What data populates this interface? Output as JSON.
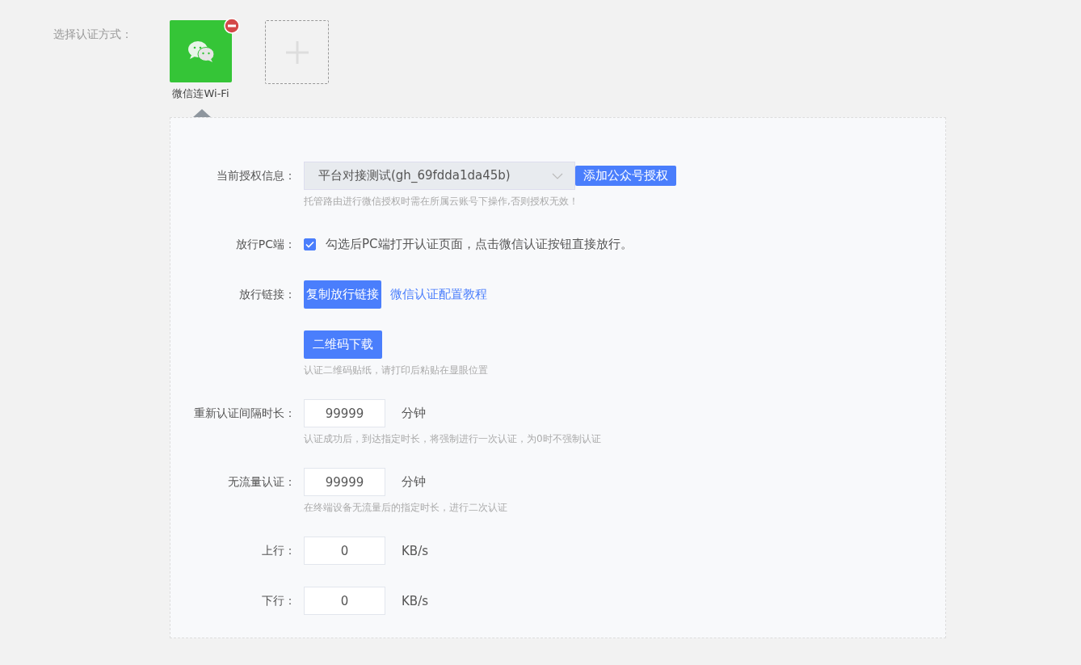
{
  "auth_method": {
    "label": "选择认证方式：",
    "methods": [
      {
        "name": "微信连Wi-Fi",
        "selected": true,
        "removable": true
      }
    ]
  },
  "panel": {
    "rows": [
      {
        "label": "当前授权信息：",
        "controls": [
          {
            "kind": "select",
            "value": "平台对接测试(gh_69fdda1da45b)"
          },
          {
            "kind": "small-button",
            "label": "添加公众号授权"
          }
        ],
        "hint": "托管路由进行微信授权时需在所属云账号下操作,否则授权无效！"
      },
      {
        "label": "放行PC端：",
        "controls": [
          {
            "kind": "checkbox",
            "checked": true,
            "label": "勾选后PC端打开认证页面，点击微信认证按钮直接放行。"
          }
        ]
      },
      {
        "label": "放行链接：",
        "controls": [
          {
            "kind": "button",
            "label": "复制放行链接"
          },
          {
            "kind": "link",
            "label": "微信认证配置教程"
          }
        ]
      },
      {
        "controls": [
          {
            "kind": "button",
            "label": "二维码下载"
          }
        ],
        "hint": "认证二维码贴纸，请打印后粘贴在显眼位置"
      },
      {
        "label": "重新认证间隔时长：",
        "controls": [
          {
            "kind": "input",
            "value": "99999"
          },
          {
            "kind": "unit",
            "label": "分钟"
          }
        ],
        "hint": "认证成功后，到达指定时长，将强制进行一次认证，为0时不强制认证"
      },
      {
        "label": "无流量认证：",
        "controls": [
          {
            "kind": "input",
            "value": "99999"
          },
          {
            "kind": "unit",
            "label": "分钟"
          }
        ],
        "hint": "在终端设备无流量后的指定时长，进行二次认证"
      },
      {
        "label": "上行：",
        "controls": [
          {
            "kind": "input",
            "value": "0"
          },
          {
            "kind": "unit",
            "label": "KB/s"
          }
        ]
      },
      {
        "label": "下行：",
        "controls": [
          {
            "kind": "input",
            "value": "0"
          },
          {
            "kind": "unit",
            "label": "KB/s"
          }
        ]
      }
    ]
  }
}
